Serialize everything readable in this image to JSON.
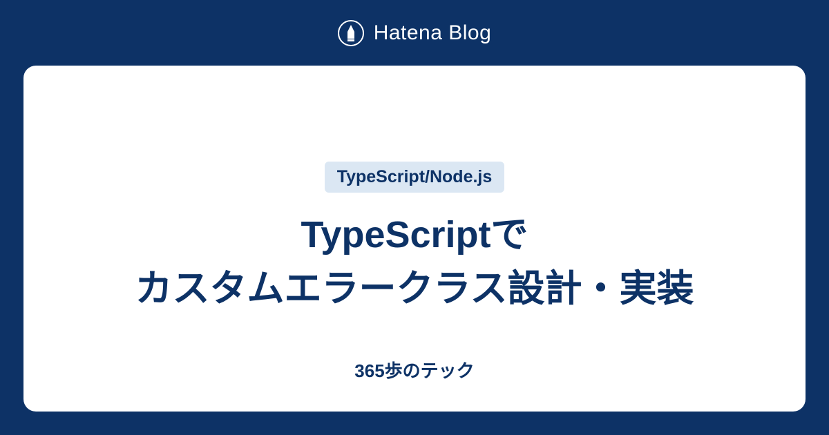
{
  "header": {
    "brand": "Hatena Blog"
  },
  "card": {
    "category": "TypeScript/Node.js",
    "title_line1": "TypeScriptで",
    "title_line2": "カスタムエラークラス設計・実装",
    "blog_name": "365歩のテック"
  },
  "colors": {
    "background": "#0d3266",
    "badge_bg": "#dbe7f3",
    "text_primary": "#0d3266",
    "white": "#ffffff"
  }
}
